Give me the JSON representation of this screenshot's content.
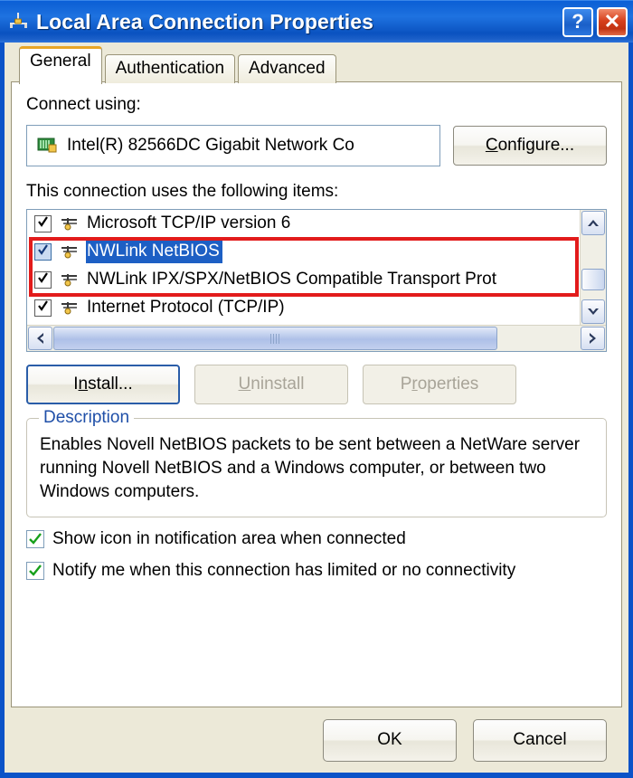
{
  "window": {
    "title": "Local Area Connection Properties",
    "icon": "network-connection-icon",
    "help_button": "?",
    "close_button": "✕"
  },
  "tabs": [
    {
      "label": "General",
      "active": true
    },
    {
      "label": "Authentication",
      "active": false
    },
    {
      "label": "Advanced",
      "active": false
    }
  ],
  "general": {
    "connect_using_label": "Connect using:",
    "adapter": {
      "name": "Intel(R) 82566DC Gigabit Network Co",
      "icon": "network-adapter-icon"
    },
    "configure_button": "Configure...",
    "items_label": "This connection uses the following items:",
    "items": [
      {
        "label": "Microsoft TCP/IP version 6",
        "checked": true,
        "selected": false
      },
      {
        "label": "NWLink NetBIOS",
        "checked": true,
        "selected": true
      },
      {
        "label": "NWLink IPX/SPX/NetBIOS Compatible Transport Prot",
        "checked": true,
        "selected": false
      },
      {
        "label": "Internet Protocol (TCP/IP)",
        "checked": true,
        "selected": false
      }
    ],
    "buttons": {
      "install": "Install...",
      "uninstall": "Uninstall",
      "properties": "Properties",
      "install_enabled": true,
      "uninstall_enabled": false,
      "properties_enabled": false
    },
    "description": {
      "title": "Description",
      "text": "Enables Novell NetBIOS packets to be sent between a NetWare server running Novell NetBIOS and a Windows computer, or between two Windows computers."
    },
    "options": [
      {
        "label": "Show icon in notification area when connected",
        "checked": true
      },
      {
        "label": "Notify me when this connection has limited or no connectivity",
        "checked": true
      }
    ]
  },
  "footer": {
    "ok": "OK",
    "cancel": "Cancel"
  },
  "annotation": {
    "color": "#E21B1B",
    "shape": "rectangle",
    "targets": [
      "NWLink NetBIOS",
      "NWLink IPX/SPX/NetBIOS Compatible Transport Prot"
    ]
  },
  "colors": {
    "titlebar_blue": "#0B53C8",
    "dialog_face": "#ECE9D8",
    "selection_blue": "#1D5FC4",
    "group_title_blue": "#1F4FA8",
    "annotation_red": "#E21B1B",
    "active_tab_accent": "#E8A526",
    "check_green": "#17A01B"
  }
}
